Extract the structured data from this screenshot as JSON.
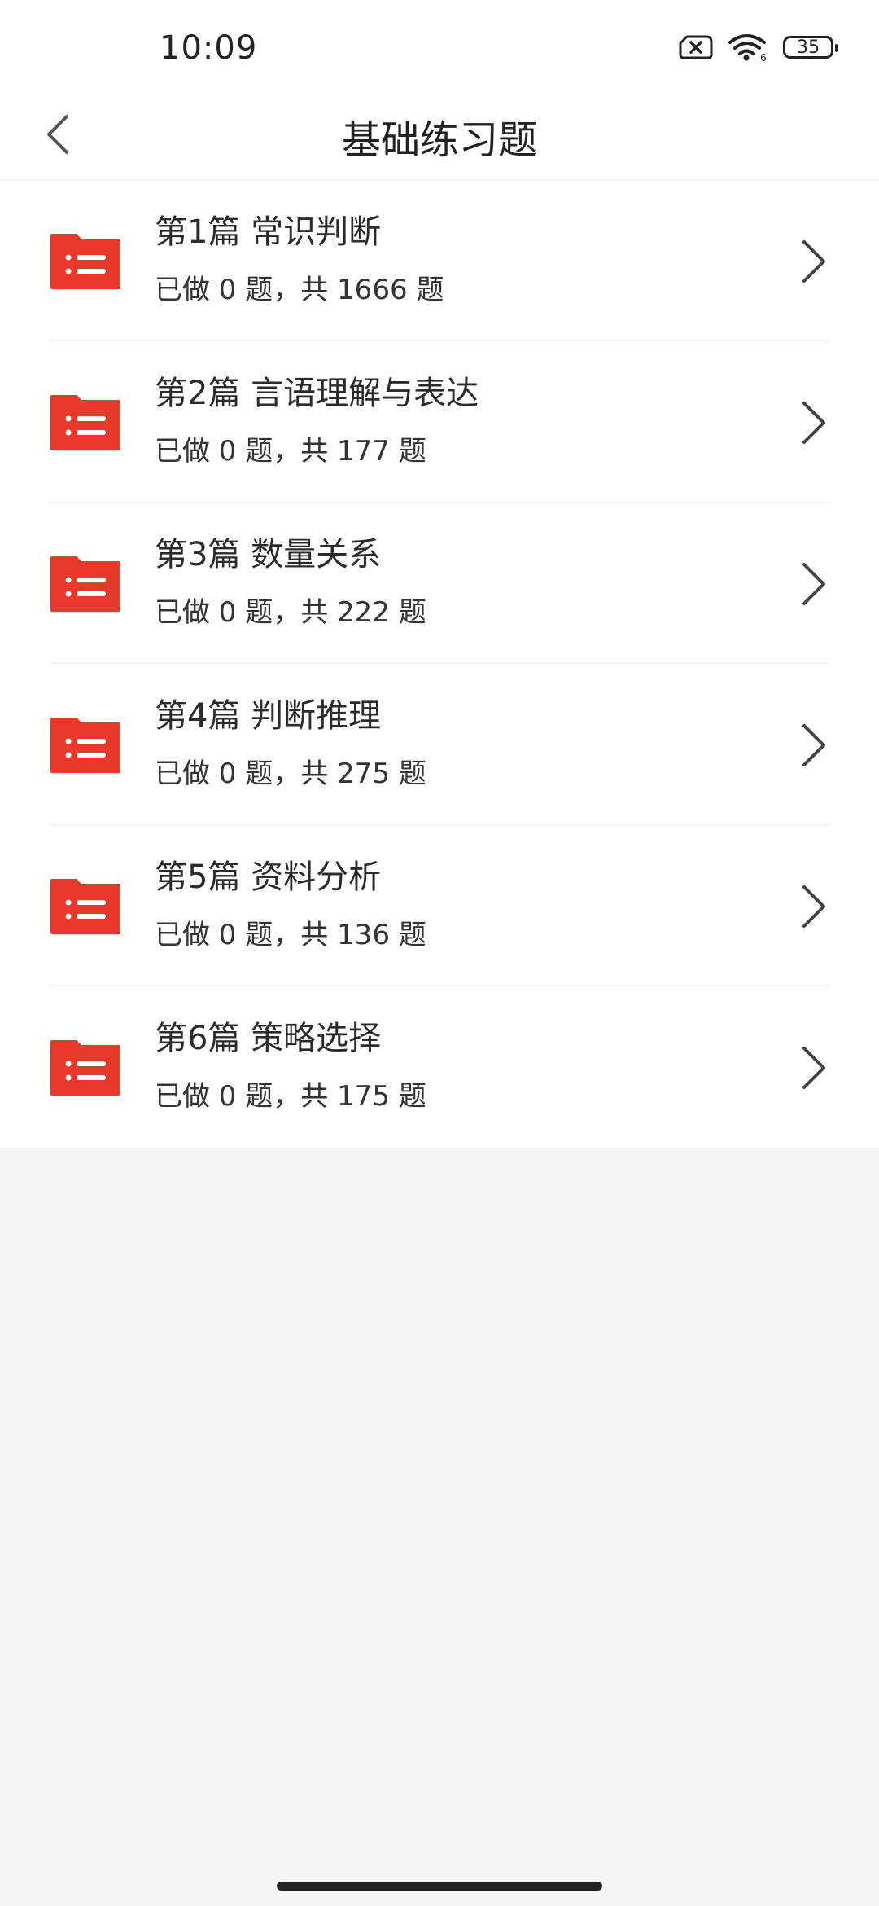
{
  "status_bar": {
    "time": "10:09",
    "battery": "35",
    "icons": [
      "sim-off-icon",
      "wifi-icon",
      "battery-icon"
    ]
  },
  "nav": {
    "title": "基础练习题",
    "back_icon": "back-chevron-icon"
  },
  "colors": {
    "accent": "#e6392c",
    "background": "#f5f5f5"
  },
  "items": [
    {
      "title": "第1篇 常识判断",
      "sub": "已做 0 题，共 1666 题",
      "icon": "folder-list-icon"
    },
    {
      "title": "第2篇 言语理解与表达",
      "sub": "已做 0 题，共 177 题",
      "icon": "folder-list-icon"
    },
    {
      "title": "第3篇 数量关系",
      "sub": "已做 0 题，共 222 题",
      "icon": "folder-list-icon"
    },
    {
      "title": "第4篇 判断推理",
      "sub": "已做 0 题，共 275 题",
      "icon": "folder-list-icon"
    },
    {
      "title": "第5篇 资料分析",
      "sub": "已做 0 题，共 136 题",
      "icon": "folder-list-icon"
    },
    {
      "title": "第6篇 策略选择",
      "sub": "已做 0 题，共 175 题",
      "icon": "folder-list-icon"
    }
  ]
}
